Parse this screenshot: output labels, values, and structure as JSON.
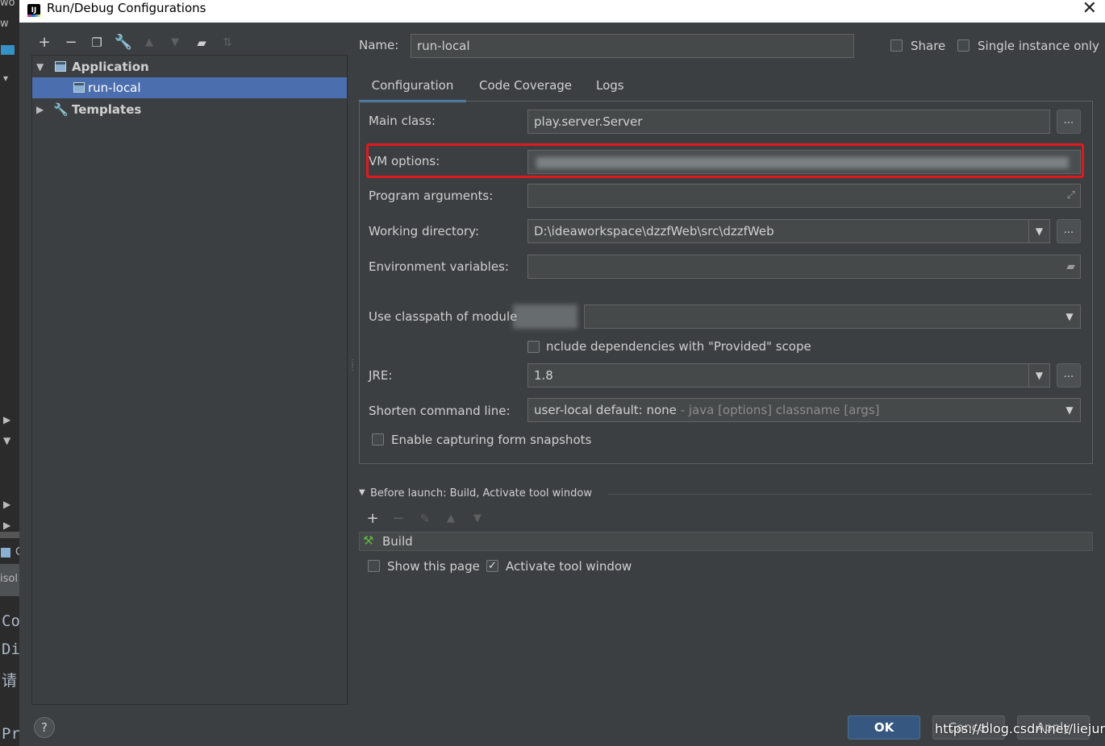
{
  "outside": {
    "frag_top": "wo",
    "frag_w": "w",
    "frag_console": "isol",
    "frag_c": "C",
    "mono_lines": [
      "Co",
      "Di",
      "请",
      "Pr"
    ]
  },
  "window": {
    "title": "Run/Debug Configurations",
    "close_glyph": "✕"
  },
  "tree": {
    "application": "Application",
    "run_local": "run-local",
    "templates": "Templates"
  },
  "header": {
    "name_label": "Name:",
    "name_value": "run-local",
    "share_label": "Share",
    "single_instance_label": "Single instance only"
  },
  "tabs": [
    "Configuration",
    "Code Coverage",
    "Logs"
  ],
  "form": {
    "main_class_label": "Main class:",
    "main_class_value": "play.server.Server",
    "vm_options_label": "VM options:",
    "program_arguments_label": "Program arguments:",
    "working_directory_label": "Working directory:",
    "working_directory_value": "D:\\ideaworkspace\\dzzfWeb\\src\\dzzfWeb",
    "env_variables_label": "Environment variables:",
    "classpath_label": "Use classpath of module",
    "include_deps_label": "nclude dependencies with \"Provided\" scope",
    "jre_label": "JRE:",
    "jre_value": "1.8",
    "shorten_label": "Shorten command line:",
    "shorten_value": "user-local default: none",
    "shorten_hint": " - java [options] classname [args]",
    "form_snapshots_label": "Enable capturing form snapshots",
    "browse_glyph": "..."
  },
  "before_launch": {
    "header": "Before launch: Build, Activate tool window",
    "build_item": "Build",
    "show_page_label": "Show this page",
    "activate_tool_label": "Activate tool window"
  },
  "buttons": {
    "ok": "OK",
    "cancel": "Cancel",
    "apply": "Apply",
    "help": "?"
  },
  "watermark": "https://blog.csdn.net/liejunfei",
  "colors": {
    "background": "#3c3f41",
    "selection": "#4b6eaf",
    "highlight_box": "#e0191e",
    "ok_button": "#365880"
  }
}
